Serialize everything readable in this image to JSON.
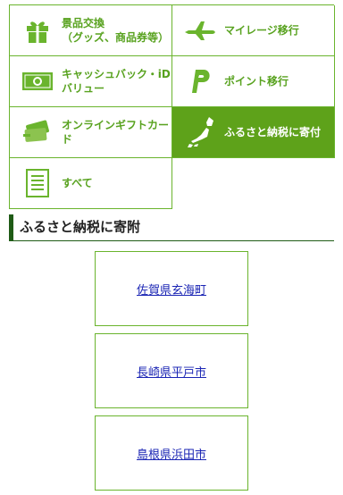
{
  "categories": [
    {
      "label": "景品交換\n（グッズ、商品券等）",
      "icon": "gift-icon",
      "active": false
    },
    {
      "label": "マイレージ移行",
      "icon": "airplane-icon",
      "active": false
    },
    {
      "label": "キャッシュバック・iD\nバリュー",
      "icon": "cash-icon",
      "active": false
    },
    {
      "label": "ポイント移行",
      "icon": "point-p-icon",
      "active": false
    },
    {
      "label": "オンラインギフトカー\nド",
      "icon": "gift-cards-icon",
      "active": false
    },
    {
      "label": "ふるさと納税に寄付",
      "icon": "japan-map-icon",
      "active": true
    },
    {
      "label": "すべて",
      "icon": "list-document-icon",
      "active": false
    }
  ],
  "section": {
    "title": "ふるさと納税に寄附"
  },
  "towns": [
    "佐賀県玄海町",
    "長崎県平戸市",
    "島根県浜田市"
  ],
  "colors": {
    "accent": "#5ea21a",
    "border": "#6ab42d",
    "heading_bar": "#1f5b16",
    "link": "#1a24b4"
  }
}
